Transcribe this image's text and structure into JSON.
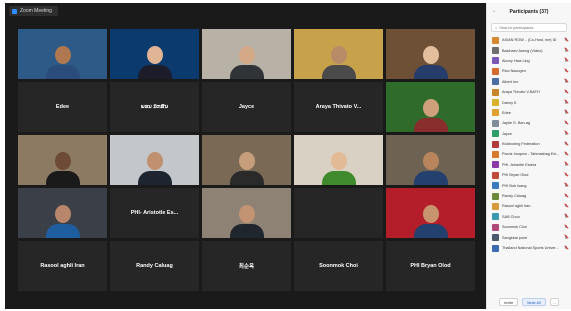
{
  "meeting": {
    "top_label": "Zoom Meeting"
  },
  "grid": {
    "tiles": [
      {
        "type": "video",
        "name": "",
        "bg": "#2d5a86",
        "skin": "#b07850",
        "shirt": "#2b4d7c"
      },
      {
        "type": "video",
        "name": "",
        "bg": "#0b3a6e",
        "skin": "#e0b494",
        "shirt": "#1c1c2a"
      },
      {
        "type": "video",
        "name": "",
        "bg": "#b7b1a6",
        "skin": "#d3a886",
        "shirt": "#303338"
      },
      {
        "type": "video",
        "name": "",
        "bg": "#c8a24a",
        "skin": "#b98c68",
        "shirt": "#4a4a4a"
      },
      {
        "type": "video",
        "name": "",
        "bg": "#6d5036",
        "skin": "#e2be9c",
        "shirt": "#263c6b"
      },
      {
        "type": "name",
        "name": "Edee"
      },
      {
        "type": "name",
        "name": "ພອນ ລັກສັນ"
      },
      {
        "type": "name",
        "name": "Jayce"
      },
      {
        "type": "name",
        "name": "Araya Thivato V..."
      },
      {
        "type": "video",
        "name": "",
        "bg": "#2f6c2b",
        "skin": "#cfa07c",
        "shirt": "#8a2d2d"
      },
      {
        "type": "video",
        "name": "",
        "bg": "#8c7a62",
        "skin": "#6e4b36",
        "shirt": "#1a1a1a"
      },
      {
        "type": "video",
        "name": "",
        "bg": "#c3c7cc",
        "skin": "#c09070",
        "shirt": "#1f2530"
      },
      {
        "type": "video",
        "name": "",
        "bg": "#7a6a55",
        "skin": "#c79e7c",
        "shirt": "#2a2a2a"
      },
      {
        "type": "video",
        "name": "",
        "bg": "#d9d2c4",
        "skin": "#e2bb96",
        "shirt": "#3f8a2c"
      },
      {
        "type": "video",
        "name": "",
        "bg": "#6e6253",
        "skin": "#b7845c",
        "shirt": "#23406e"
      },
      {
        "type": "video",
        "name": "",
        "bg": "#3a3f48",
        "skin": "#b8866a",
        "shirt": "#1f5e9e"
      },
      {
        "type": "name",
        "name": "PHI- Aristotle Es..."
      },
      {
        "type": "video",
        "name": "",
        "bg": "#8d8274",
        "skin": "#c39473",
        "shirt": "#20262e"
      },
      {
        "type": "name",
        "name": ""
      },
      {
        "type": "video",
        "name": "",
        "bg": "#b41e2a",
        "skin": "#c89470",
        "shirt": "#23406e"
      },
      {
        "type": "name",
        "name": "Rasool aghli Iran"
      },
      {
        "type": "name",
        "name": "Randy Caluag"
      },
      {
        "type": "name",
        "name": "최순옥"
      },
      {
        "type": "name",
        "name": "Soonmok Choi"
      },
      {
        "type": "name",
        "name": "PHI Bryan Olod"
      }
    ]
  },
  "panel": {
    "title": "Participants (37)",
    "collapse_icon": "chevron-down-icon",
    "search_placeholder": "Search participants",
    "participants": [
      {
        "name": "ASIAN ROW... (Co-Host, me) ID",
        "color": "#d8892f"
      },
      {
        "name": "Baichaev Aseng (Video)",
        "color": "#6e6e6e"
      },
      {
        "name": "Abuny Hwa Ling",
        "color": "#7a58b5"
      },
      {
        "name": "Rico Nacugen",
        "color": "#d56b2c"
      },
      {
        "name": "Albert Ino",
        "color": "#4a6fa5"
      },
      {
        "name": "Araya Thivato V-BATH",
        "color": "#c8862a"
      },
      {
        "name": "Danny K",
        "color": "#d8b22a"
      },
      {
        "name": "Edee",
        "color": "#e0a030"
      },
      {
        "name": "Jaybe S. Ban-ag",
        "color": "#7f8c9a"
      },
      {
        "name": "Jayce",
        "color": "#2e9e6a"
      },
      {
        "name": "Kickboxing Federation",
        "color": "#b33a3a"
      },
      {
        "name": "Parviz Inoqovs - Tahmasbag Exi...",
        "color": "#d87a2c"
      },
      {
        "name": "PHI- Aristotle Estera",
        "color": "#8a3aa8"
      },
      {
        "name": "PHI Bryan Olod",
        "color": "#c0493a"
      },
      {
        "name": "PHI Bob Isang",
        "color": "#3a7ac0"
      },
      {
        "name": "Randy Caluag",
        "color": "#6a8a3a"
      },
      {
        "name": "Rasool aghli Iran",
        "color": "#d89a3a"
      },
      {
        "name": "SAB Choo",
        "color": "#3a9ab0"
      },
      {
        "name": "Soonmok Choi",
        "color": "#b04a7a"
      },
      {
        "name": "Sangkbal point",
        "color": "#4a5a6a"
      },
      {
        "name": "Thailand National Sports Univer...",
        "color": "#3a6ab0"
      }
    ],
    "footer": {
      "invite_label": "Invite",
      "mute_all_label": "Mute All",
      "more_label": "..."
    }
  }
}
